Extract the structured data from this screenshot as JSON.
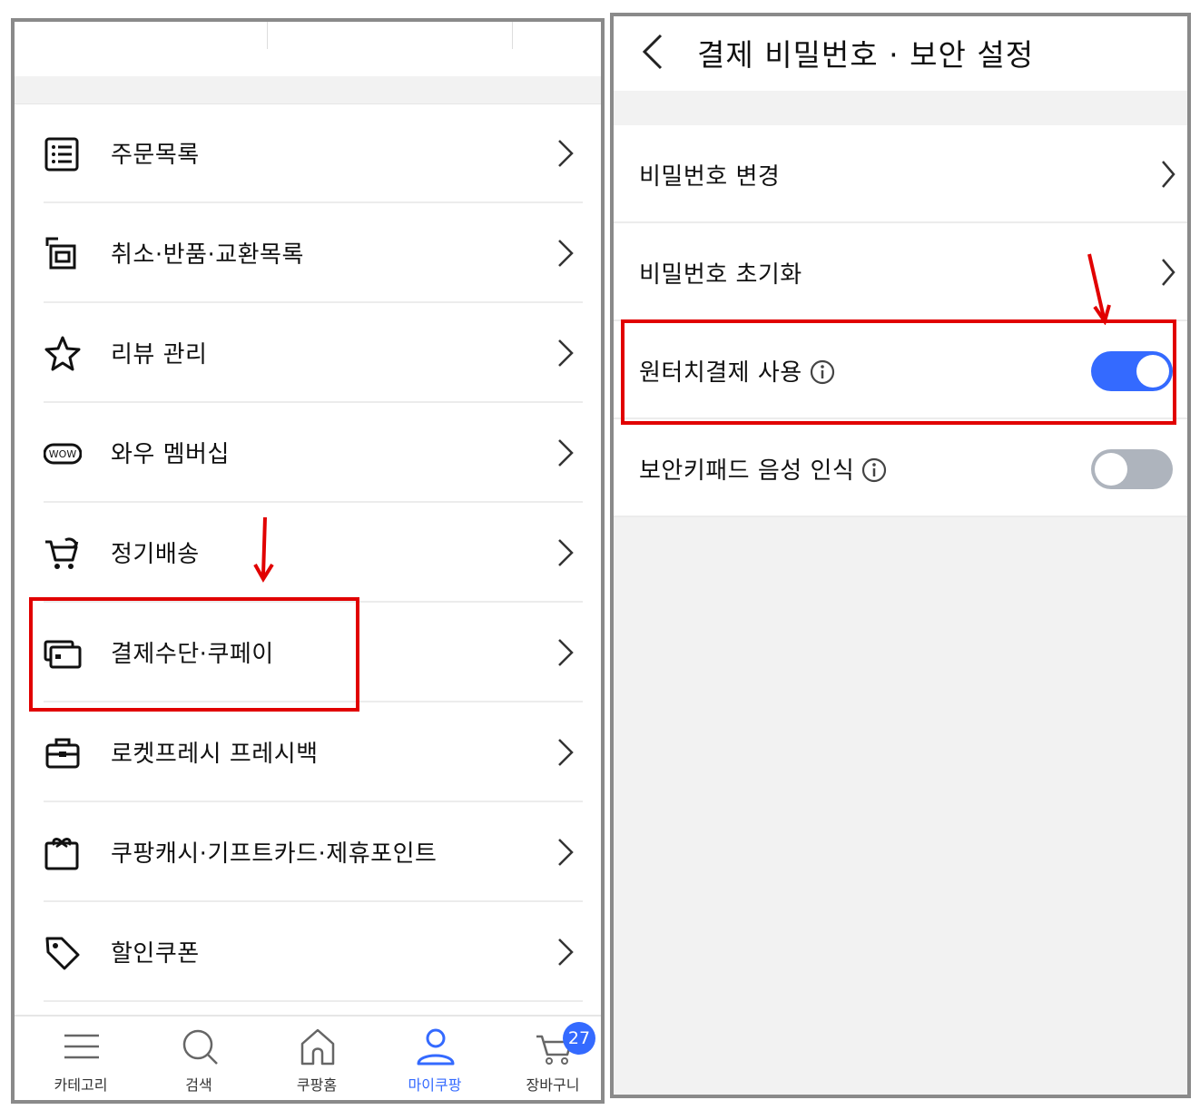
{
  "left_screen": {
    "menu": [
      {
        "label": "주문목록",
        "icon": "order-list-icon"
      },
      {
        "label": "취소·반품·교환목록",
        "icon": "return-icon"
      },
      {
        "label": "리뷰 관리",
        "icon": "star-icon"
      },
      {
        "label": "와우 멤버십",
        "icon": "wow-icon",
        "icon_text": "WOW"
      },
      {
        "label": "정기배송",
        "icon": "subscription-cart-icon"
      },
      {
        "label": "결제수단·쿠페이",
        "icon": "payment-card-icon",
        "highlighted": true
      },
      {
        "label": "로켓프레시 프레시백",
        "icon": "fresh-bag-icon"
      },
      {
        "label": "쿠팡캐시·기프트카드·제휴포인트",
        "icon": "gift-card-icon"
      },
      {
        "label": "할인쿠폰",
        "icon": "coupon-tag-icon"
      }
    ],
    "tabbar": [
      {
        "label": "카테고리",
        "icon": "menu-icon"
      },
      {
        "label": "검색",
        "icon": "search-icon"
      },
      {
        "label": "쿠팡홈",
        "icon": "home-icon"
      },
      {
        "label": "마이쿠팡",
        "icon": "user-icon",
        "active": true
      },
      {
        "label": "장바구니",
        "icon": "cart-icon",
        "badge": "27"
      }
    ]
  },
  "right_screen": {
    "title": "결제 비밀번호 · 보안 설정",
    "items": [
      {
        "label": "비밀번호 변경",
        "type": "link"
      },
      {
        "label": "비밀번호 초기화",
        "type": "link"
      },
      {
        "label": "원터치결제 사용",
        "type": "toggle",
        "on": true,
        "info": true,
        "highlighted": true
      },
      {
        "label": "보안키패드 음성 인식",
        "type": "toggle",
        "on": false,
        "info": true
      }
    ]
  },
  "colors": {
    "accent": "#346aff",
    "highlight": "#e10000",
    "toggle_off": "#aeb4bd",
    "panel_border": "#8a8a8a"
  }
}
